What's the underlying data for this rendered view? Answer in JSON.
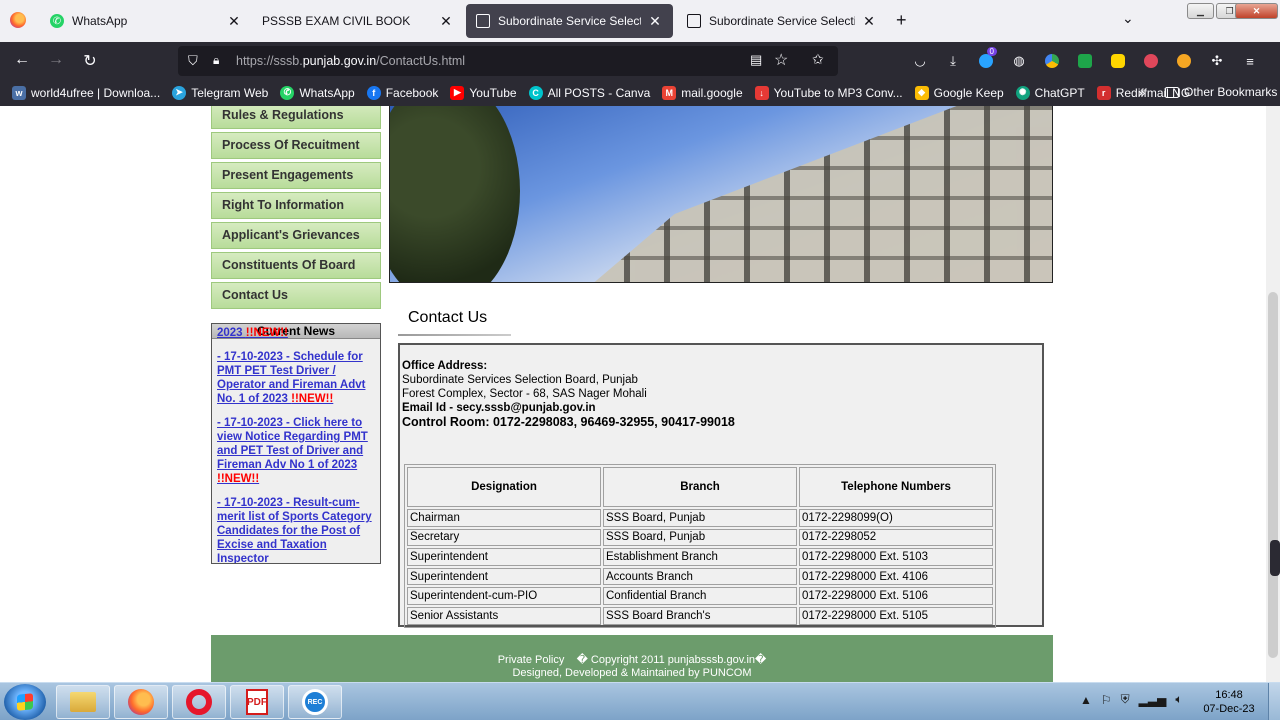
{
  "browser": {
    "tabs": [
      {
        "title": "WhatsApp",
        "icon": "whatsapp-icon",
        "active": false
      },
      {
        "title": "PSSSB EXAM CIVIL BOOK",
        "icon": "",
        "active": false
      },
      {
        "title": "Subordinate Service Selection B",
        "icon": "page-icon",
        "active": true
      },
      {
        "title": "Subordinate Service Selection B",
        "icon": "page-icon",
        "active": false
      }
    ],
    "close_glyph": "✕",
    "new_tab_glyph": "+",
    "url_prefix": "https://sssb.",
    "url_domain": "punjab.gov.in",
    "url_path": "/ContactUs.html",
    "extension_badge": "0",
    "bookmarks": [
      {
        "label": "world4ufree | Downloa...",
        "icon_color": "#4a6fa5",
        "glyph": "w"
      },
      {
        "label": "Telegram Web",
        "icon_color": "#2aa3dd",
        "glyph": "➤"
      },
      {
        "label": "WhatsApp",
        "icon_color": "#25d366",
        "glyph": "✆"
      },
      {
        "label": "Facebook",
        "icon_color": "#1877f2",
        "glyph": "f"
      },
      {
        "label": "YouTube",
        "icon_color": "#ff0000",
        "glyph": "▶"
      },
      {
        "label": "All POSTS - Canva",
        "icon_color": "#00c4cc",
        "glyph": "C"
      },
      {
        "label": "mail.google",
        "icon_color": "#ea4335",
        "glyph": "M"
      },
      {
        "label": "YouTube to MP3 Conv...",
        "icon_color": "#e53935",
        "glyph": "↓"
      },
      {
        "label": "Google Keep",
        "icon_color": "#fbbc04",
        "glyph": "◆"
      },
      {
        "label": "ChatGPT",
        "icon_color": "#10a37f",
        "glyph": "✺"
      },
      {
        "label": "Rediffmail NG",
        "icon_color": "#d32f2f",
        "glyph": "r"
      }
    ],
    "bookmarks_more": "»",
    "other_bookmarks": "Other Bookmarks"
  },
  "sidebar_menu": [
    "Rules & Regulations",
    "Process Of Recuitment",
    "Present Engagements",
    "Right To Information",
    "Applicant's Grievances",
    "Constituents Of Board",
    "Contact Us"
  ],
  "news": {
    "title": "Current News",
    "items": [
      {
        "text": "2023 ",
        "new": "!!NEW!!"
      },
      {
        "text": "- 17-10-2023 - Schedule for PMT PET Test Driver / Operator and Fireman Advt No. 1 of 2023 ",
        "new": "!!NEW!!"
      },
      {
        "text": "- 17-10-2023 - Click here to view Notice Regarding PMT and PET Test of Driver and Fireman Adv No 1 of 2023 ",
        "new": "!!NEW!!"
      },
      {
        "text": "- 17-10-2023 - Result-cum-merit list of Sports Category Candidates for the Post of Excise and Taxation Inspector",
        "new": ""
      }
    ]
  },
  "contact": {
    "heading": "Contact Us",
    "office_label": "Office Address:",
    "address_line1": "Subordinate Services Selection Board, Punjab",
    "address_line2": "Forest Complex, Sector - 68, SAS Nager Mohali",
    "email": "Email Id - secy.sssb@punjab.gov.in",
    "control_room": "Control Room: 0172-2298083, 96469-32955, 90417-99018",
    "table": {
      "headers": [
        "Designation",
        "Branch",
        "Telephone Numbers"
      ],
      "rows": [
        [
          "Chairman",
          "SSS Board, Punjab",
          "0172-2298099(O)"
        ],
        [
          "Secretary",
          "SSS Board, Punjab",
          "0172-2298052"
        ],
        [
          "Superintendent",
          "Establishment Branch",
          "0172-2298000 Ext. 5103"
        ],
        [
          "Superintendent",
          "Accounts Branch",
          "0172-2298000 Ext. 4106"
        ],
        [
          "Superintendent-cum-PIO",
          "Confidential Branch",
          "0172-2298000 Ext. 5106"
        ],
        [
          "Senior Assistants",
          "SSS Board Branch's",
          "0172-2298000 Ext. 5105"
        ]
      ]
    }
  },
  "footer": {
    "privacy": "Private Policy",
    "copyright": "� Copyright 2011 punjabsssb.gov.in�",
    "credit": "Designed, Developed & Maintained by PUNCOM"
  },
  "taskbar": {
    "time": "16:48",
    "date": "07-Dec-23",
    "pdf_label": "PDF",
    "rec_label": "REC"
  },
  "colors": {
    "menu_green": "#b8dc9a",
    "footer_green": "#6c9c6c",
    "news_link": "#3333cc",
    "new_badge": "#ff0000",
    "browser_dark": "#2b2a33"
  }
}
